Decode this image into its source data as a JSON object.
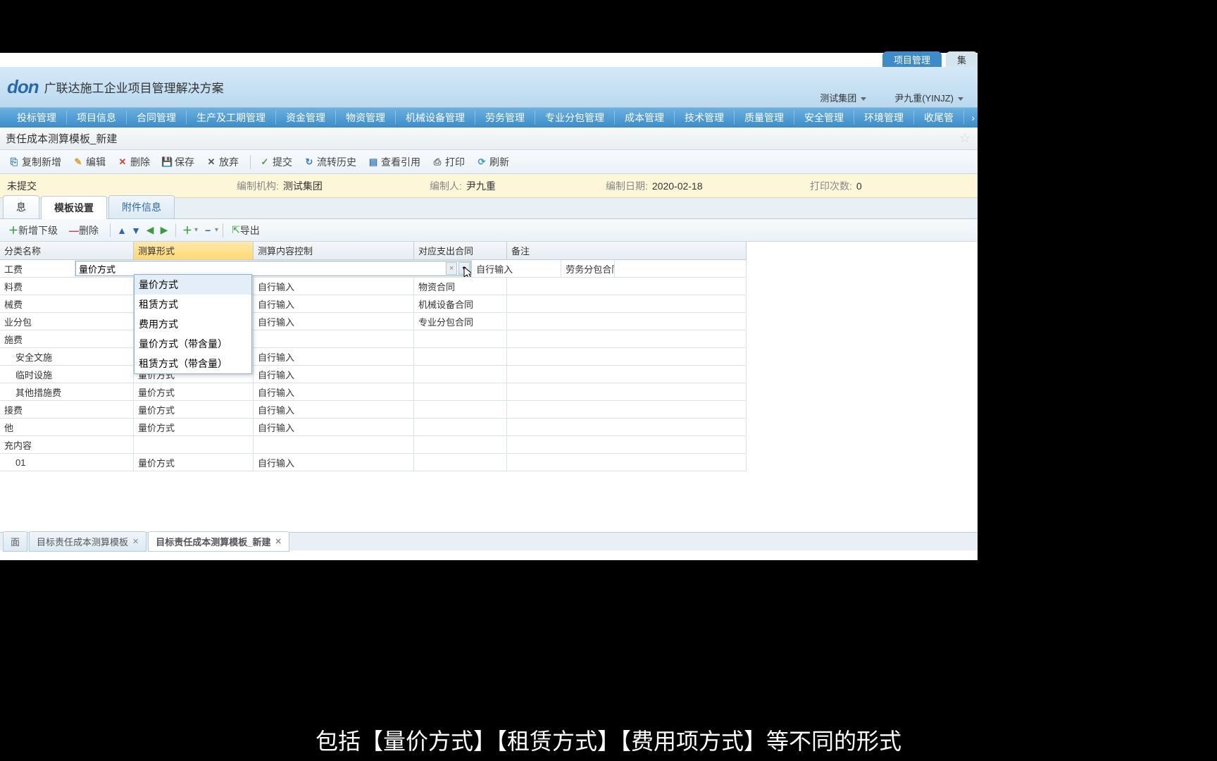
{
  "topTabs": {
    "primary": "项目管理",
    "secondary": "集"
  },
  "logo": {
    "brand": "don",
    "subtitle": "广联达施工企业项目管理解决方案"
  },
  "orgUser": {
    "org": "测试集团",
    "user": "尹九重(YINJZ)"
  },
  "nav": [
    "投标管理",
    "项目信息",
    "合同管理",
    "生产及工期管理",
    "资金管理",
    "物资管理",
    "机械设备管理",
    "劳务管理",
    "专业分包管理",
    "成本管理",
    "技术管理",
    "质量管理",
    "安全管理",
    "环境管理",
    "收尾管"
  ],
  "pageTitle": "责任成本测算模板_新建",
  "toolbar": {
    "copy": "复制新增",
    "edit": "编辑",
    "delete": "删除",
    "save": "保存",
    "cancel": "放弃",
    "submit": "提交",
    "history": "流转历史",
    "viewRef": "查看引用",
    "print": "打印",
    "refresh": "刷新"
  },
  "infoBar": {
    "statusLabel": "未提交",
    "orgLabel": "编制机构:",
    "orgValue": "测试集团",
    "authorLabel": "编制人:",
    "authorValue": "尹九重",
    "dateLabel": "编制日期:",
    "dateValue": "2020-02-18",
    "printLabel": "打印次数:",
    "printValue": "0"
  },
  "subTabs": {
    "info": "息",
    "template": "模板设置",
    "attach": "附件信息"
  },
  "gridToolbar": {
    "addChild": "新增下级",
    "delete": "删除",
    "export": "导出"
  },
  "columns": {
    "name": "分类名称",
    "form": "测算形式",
    "ctrl": "测算内容控制",
    "contract": "对应支出合同",
    "remark": "备注"
  },
  "editor": {
    "value": "量价方式"
  },
  "dropdown": [
    "量价方式",
    "租赁方式",
    "费用方式",
    "量价方式（带含量）",
    "租赁方式（带含量）"
  ],
  "rows": [
    {
      "name": "工费",
      "form": "",
      "ctrl": "自行输入",
      "contract": "劳务分包合同",
      "indent": 0,
      "editing": true
    },
    {
      "name": "料费",
      "form": "",
      "ctrl": "自行输入",
      "contract": "物资合同",
      "indent": 0
    },
    {
      "name": "械费",
      "form": "",
      "ctrl": "自行输入",
      "contract": "机械设备合同",
      "indent": 0
    },
    {
      "name": "业分包",
      "form": "",
      "ctrl": "自行输入",
      "contract": "专业分包合同",
      "indent": 0
    },
    {
      "name": "施费",
      "form": "",
      "ctrl": "",
      "contract": "",
      "indent": 0
    },
    {
      "name": "安全文施",
      "form": "",
      "ctrl": "自行输入",
      "contract": "",
      "indent": 1
    },
    {
      "name": "临时设施",
      "form": "量价方式",
      "ctrl": "自行输入",
      "contract": "",
      "indent": 1
    },
    {
      "name": "其他措施费",
      "form": "量价方式",
      "ctrl": "自行输入",
      "contract": "",
      "indent": 1
    },
    {
      "name": "接费",
      "form": "量价方式",
      "ctrl": "自行输入",
      "contract": "",
      "indent": 0
    },
    {
      "name": "他",
      "form": "量价方式",
      "ctrl": "自行输入",
      "contract": "",
      "indent": 0
    },
    {
      "name": "充内容",
      "form": "",
      "ctrl": "",
      "contract": "",
      "indent": 0
    },
    {
      "name": "01",
      "form": "量价方式",
      "ctrl": "自行输入",
      "contract": "",
      "indent": 1
    }
  ],
  "bottomTabs": {
    "first": "面",
    "template": "目标责任成本测算模板",
    "templateNew": "目标责任成本测算模板_新建"
  },
  "subtitle": "包括【量价方式】【租赁方式】【费用项方式】等不同的形式"
}
